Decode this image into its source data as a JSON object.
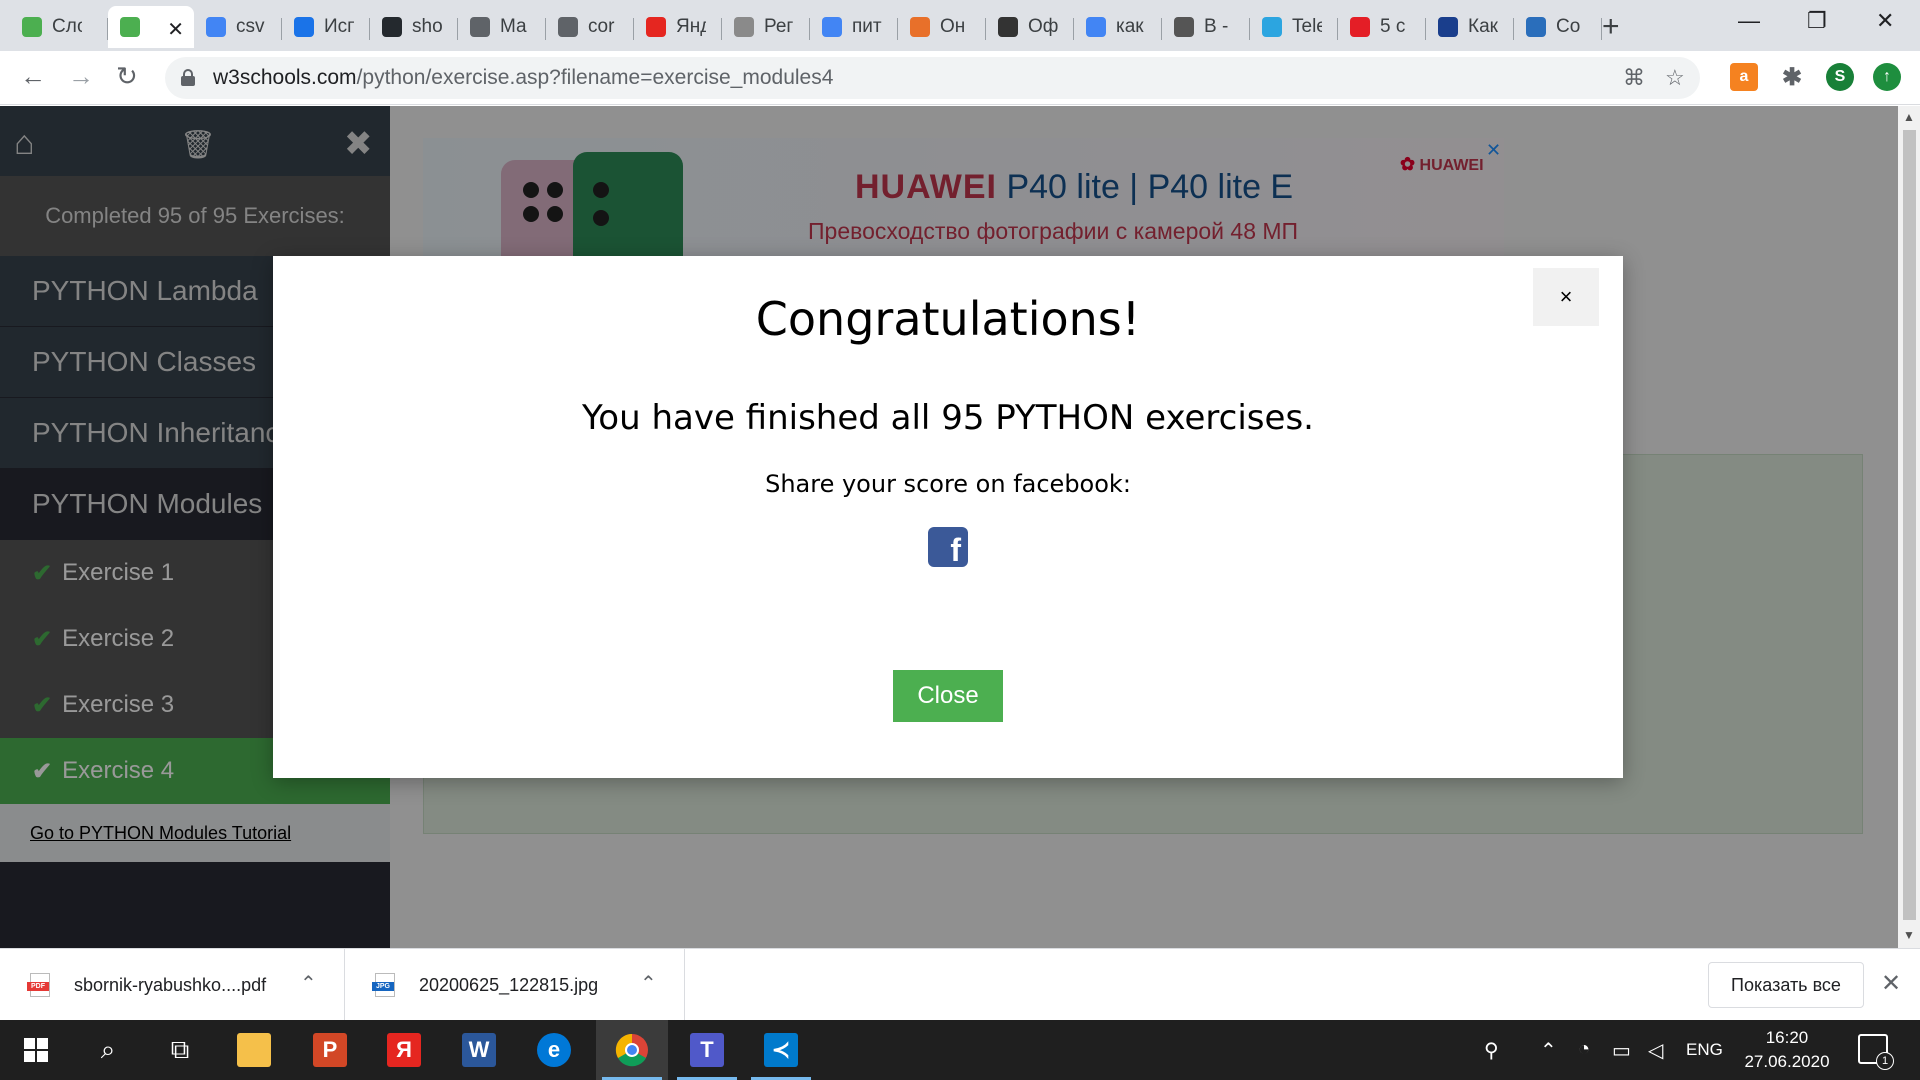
{
  "tabs": [
    {
      "title": "Сло",
      "favicon": "w3-icon",
      "color": "#4CAF50"
    },
    {
      "title": "",
      "favicon": "w3-icon",
      "color": "#4CAF50",
      "active": true
    },
    {
      "title": "csv",
      "favicon": "google-icon",
      "color": "#4285F4"
    },
    {
      "title": "Исп",
      "favicon": "globe-icon",
      "color": "#1a73e8"
    },
    {
      "title": "sho",
      "favicon": "github-icon",
      "color": "#24292e"
    },
    {
      "title": "Ма",
      "favicon": "globe-icon",
      "color": "#5f6368"
    },
    {
      "title": "cor",
      "favicon": "globe-icon",
      "color": "#5f6368"
    },
    {
      "title": "Янд",
      "favicon": "yandex-icon",
      "color": "#e52620"
    },
    {
      "title": "Рег",
      "favicon": "w3r-icon",
      "color": "#8a8a8a"
    },
    {
      "title": "пит",
      "favicon": "google-icon",
      "color": "#4285F4"
    },
    {
      "title": "Он",
      "favicon": "fox-icon",
      "color": "#e8702a"
    },
    {
      "title": "Оф",
      "favicon": "cap-icon",
      "color": "#333333"
    },
    {
      "title": "как",
      "favicon": "google-icon",
      "color": "#4285F4"
    },
    {
      "title": "В -",
      "favicon": "robot-icon",
      "color": "#555555"
    },
    {
      "title": "Tele",
      "favicon": "telegram-icon",
      "color": "#2ca5e0"
    },
    {
      "title": "5 с",
      "favicon": "swiss-icon",
      "color": "#e41e26"
    },
    {
      "title": "Как",
      "favicon": "s-icon",
      "color": "#1a3e8c"
    },
    {
      "title": "Со",
      "favicon": "chat-icon",
      "color": "#2a6ebb"
    }
  ],
  "address": {
    "domain": "w3schools.com",
    "path": "/python/exercise.asp?filename=exercise_modules4"
  },
  "profile_initial": "S",
  "sidebar": {
    "completed": "Completed 95 of 95 Exercises:",
    "categories": [
      "PYTHON Lambda",
      "PYTHON Classes",
      "PYTHON Inheritance",
      "PYTHON Modules"
    ],
    "exercises": [
      "Exercise 1",
      "Exercise 2",
      "Exercise 3",
      "Exercise 4"
    ],
    "tutorial_link": "Go to PYTHON Modules Tutorial"
  },
  "ad": {
    "brand": "HUAWEI",
    "model": "P40 lite | P40 lite E",
    "subtitle": "Превосходство фотографии с камерой 48 МП",
    "logo": "HUAWEI"
  },
  "modal": {
    "title": "Congratulations!",
    "message": "You have finished all 95 PYTHON exercises.",
    "share": "Share your score on facebook:",
    "close_label": "Close",
    "close_x": "×"
  },
  "downloads": [
    {
      "name": "sbornik-ryabushko....pdf",
      "type": "PDF"
    },
    {
      "name": "20200625_122815.jpg",
      "type": "JPG"
    }
  ],
  "show_all": "Показать все",
  "taskbar": {
    "lang": "ENG",
    "time": "16:20",
    "date": "27.06.2020",
    "notifications": "1"
  },
  "colors": {
    "w3_green": "#4CAF50",
    "sidebar_dark": "#282a35",
    "facebook": "#3b5998"
  }
}
